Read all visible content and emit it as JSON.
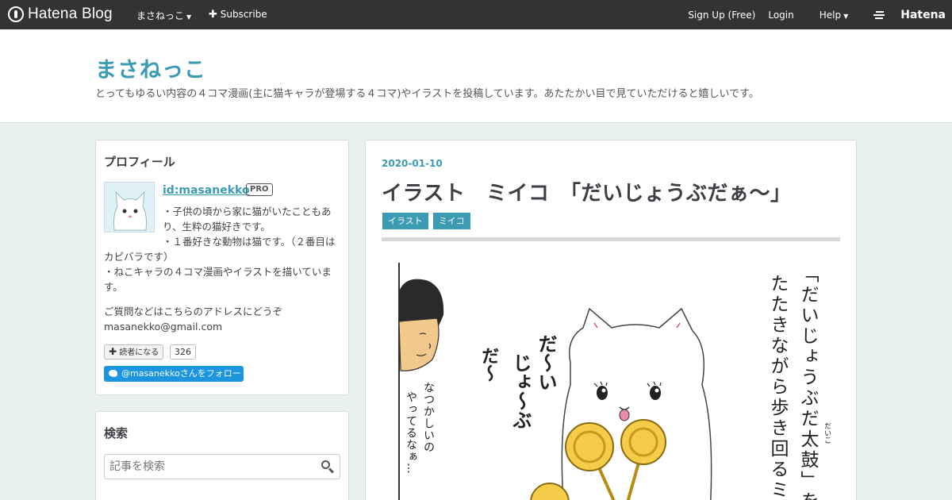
{
  "globalbar": {
    "logo_text": "Hatena Blog",
    "blog_name": "まさねっこ",
    "subscribe_label": "Subscribe",
    "signup_label": "Sign Up (Free)",
    "login_label": "Login",
    "help_label": "Help",
    "hatena_label": "Hatena"
  },
  "header": {
    "title": "まさねっこ",
    "description": "とってもゆるい内容の４コマ漫画(主に猫キャラが登場する４コマ)やイラストを投稿しています。あたたかい目で見ていただけると嬉しいです。"
  },
  "profile": {
    "title": "プロフィール",
    "id": "id:masanekko",
    "badge": "PRO",
    "line1": "・子供の頃から家に猫がいたこともあり、生粋の猫好きです。",
    "line2": "・１番好きな動物は猫です。（２番目はカピバラです）",
    "line3": "・ねこキャラの４コマ漫画やイラストを描いています。",
    "contact_line1": "ご質問などはこちらのアドレスにどうぞ",
    "contact_line2": "masanekko@gmail.com",
    "reader_label": "読者になる",
    "reader_count": "326",
    "twitter_label": "@masanekkoさんをフォロー"
  },
  "search": {
    "title": "検索",
    "placeholder": "記事を検索"
  },
  "entry": {
    "date": "2020-01-10",
    "title": "イラスト　ミイコ　「だいじょうぶだぁ〜」",
    "categories": [
      "イラスト",
      "ミイコ"
    ]
  },
  "illustration": {
    "narration_col1": "「だいじょうぶだ太鼓」を",
    "narration_col2": "たたきながら歩き回るミ",
    "furigana": "だいこ",
    "shout_col1": "だ〜い",
    "shout_col2": "じょ〜ぶ",
    "shout_col3": "だ〜",
    "boy_col1": "なつかしいの",
    "boy_col2": "やってるなぁ…"
  },
  "colors": {
    "accent": "#3a9bb3",
    "globalbar": "#333333",
    "background": "#e9f1ee",
    "twitter": "#1b95e0",
    "drum": "#f4cc4a"
  }
}
